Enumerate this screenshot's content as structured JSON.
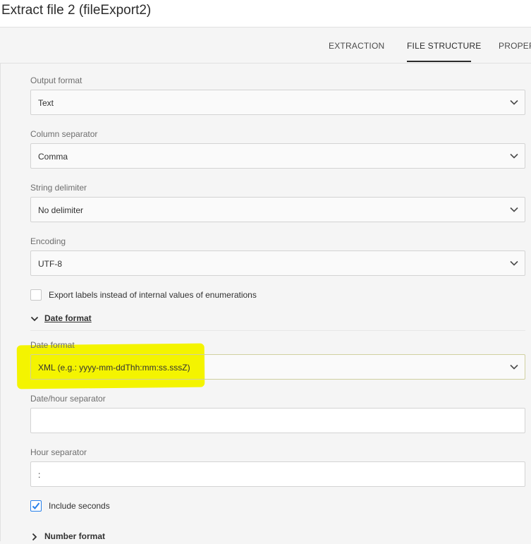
{
  "window": {
    "title": "Extract file 2 (fileExport2)"
  },
  "tabs": [
    {
      "label": "EXTRACTION",
      "active": false
    },
    {
      "label": "FILE STRUCTURE",
      "active": true
    },
    {
      "label": "PROPERTIES",
      "active": false
    }
  ],
  "form": {
    "output_format": {
      "label": "Output format",
      "value": "Text"
    },
    "column_separator": {
      "label": "Column separator",
      "value": "Comma"
    },
    "string_delimiter": {
      "label": "String delimiter",
      "value": "No delimiter"
    },
    "encoding": {
      "label": "Encoding",
      "value": "UTF-8"
    },
    "export_labels": {
      "label": "Export labels instead of internal values of enumerations",
      "checked": false
    },
    "date_format_section": {
      "label": "Date format",
      "expanded": true
    },
    "date_format": {
      "label": "Date format",
      "value": "XML (e.g.: yyyy-mm-ddThh:mm:ss.sssZ)"
    },
    "date_hour_separator": {
      "label": "Date/hour separator",
      "value": ""
    },
    "hour_separator": {
      "label": "Hour separator",
      "value": ":"
    },
    "include_seconds": {
      "label": "Include seconds",
      "checked": true
    },
    "number_format_section": {
      "label": "Number format",
      "expanded": false
    }
  },
  "colors": {
    "accent": "#2680eb",
    "highlight": "#f4f400"
  }
}
